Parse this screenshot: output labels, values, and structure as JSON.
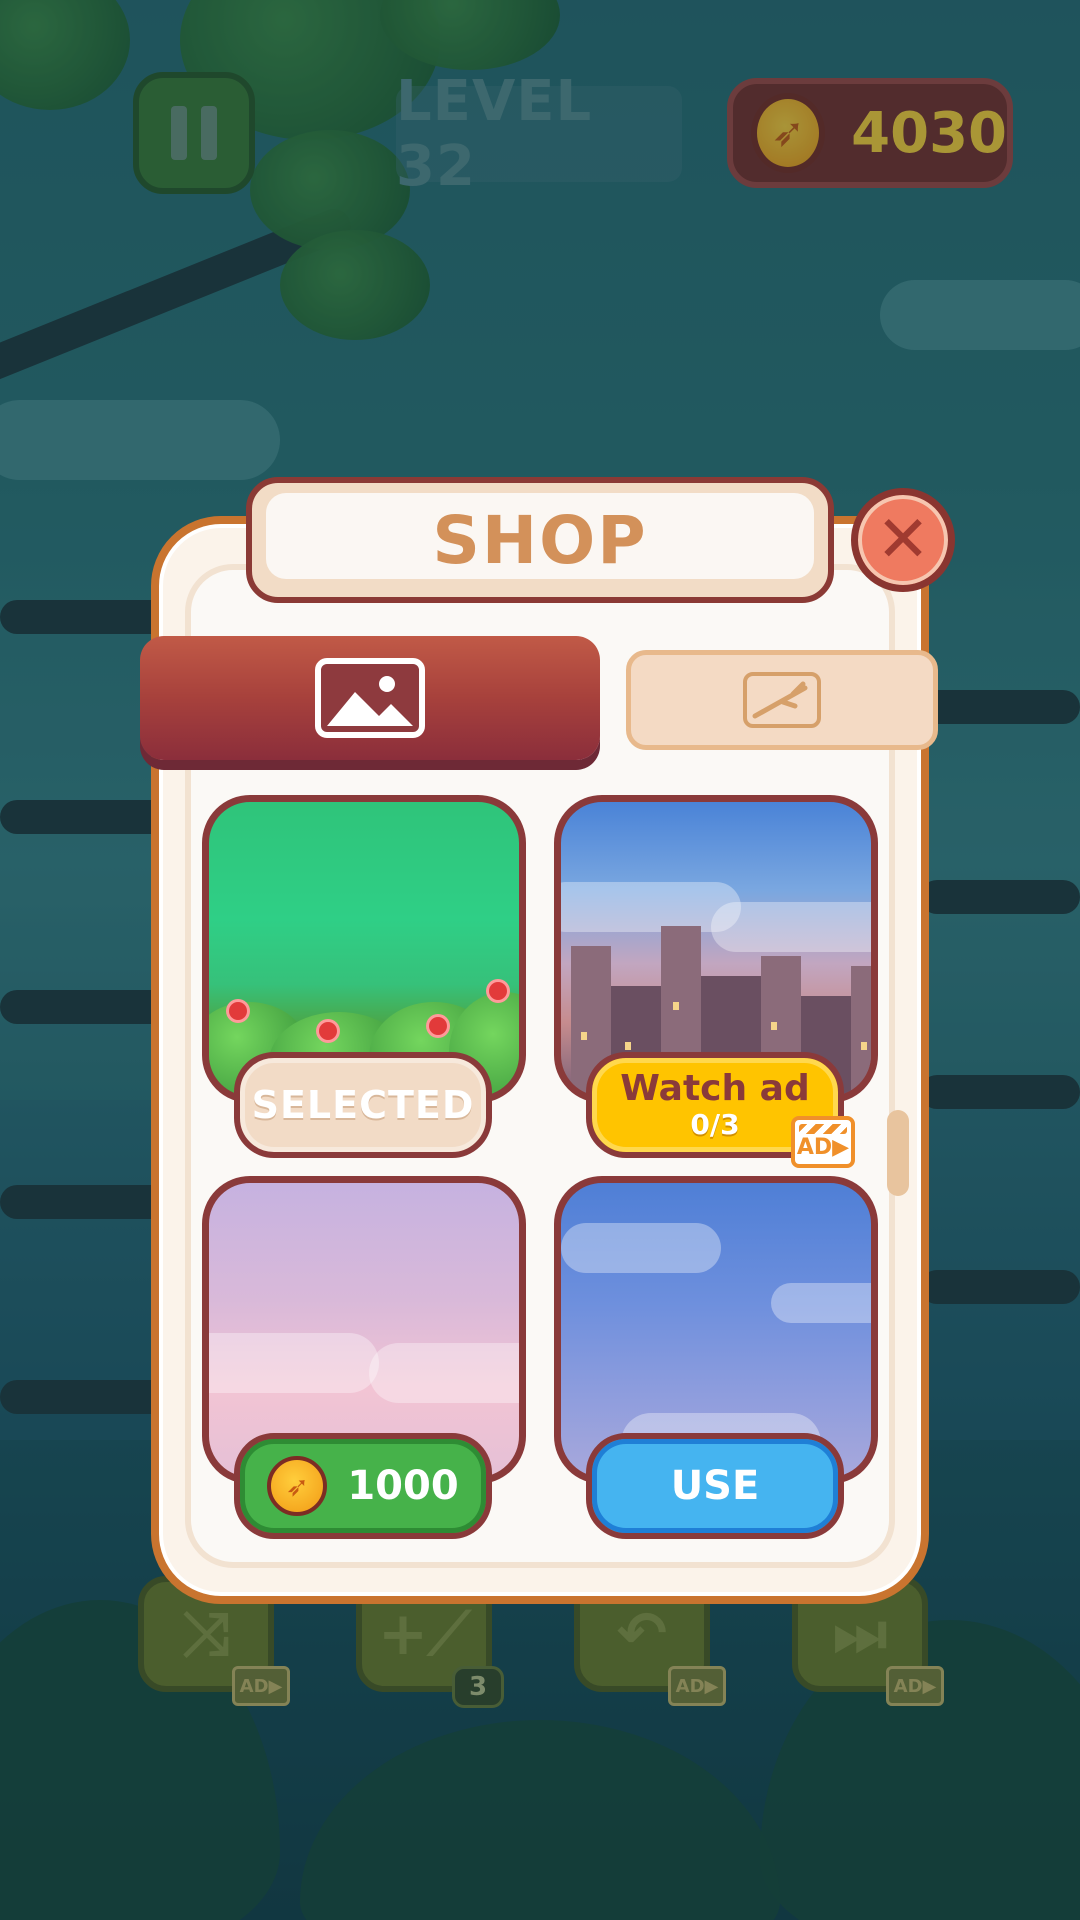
{
  "hud": {
    "level_label": "LEVEL 32",
    "coins": "4030"
  },
  "tools": {
    "shuffle_tag": "AD▶",
    "add_branch_count": "3",
    "undo_tag": "AD▶",
    "skip_tag": "AD▶"
  },
  "shop": {
    "title": "SHOP",
    "tabs": [
      {
        "name": "backgrounds",
        "icon": "image-icon",
        "active": true
      },
      {
        "name": "branches",
        "icon": "branch-icon",
        "active": false
      }
    ],
    "items": [
      {
        "theme": "jungle",
        "button": "SELECTED"
      },
      {
        "theme": "city",
        "button_line1": "Watch ad",
        "button_line2": "0/3",
        "badge": "AD▶"
      },
      {
        "theme": "pink-sky",
        "price": "1000"
      },
      {
        "theme": "blue-sky",
        "button": "USE"
      }
    ]
  },
  "colors": {
    "modal_border": "#c9742f",
    "active_tab": "#a7413c",
    "selected_button": "#f2dbc6",
    "watch_ad_button": "#ffc400",
    "buy_button": "#46b24a",
    "use_button": "#45b4f0",
    "coin": "#ffd23a"
  }
}
